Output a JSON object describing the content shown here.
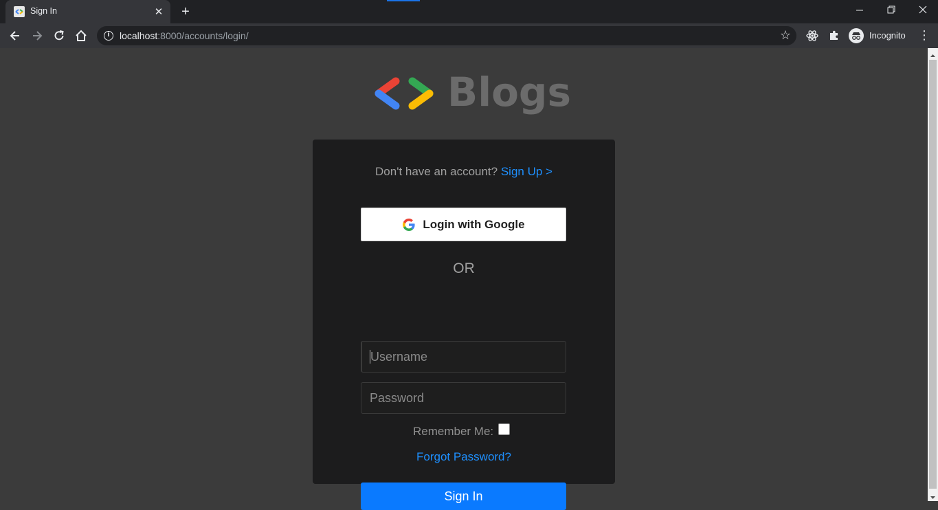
{
  "browser": {
    "tab_title": "Sign In",
    "tab_close": "✕",
    "new_tab": "+",
    "url_host": "localhost",
    "url_rest": ":8000/accounts/login/",
    "profile_label": "Incognito",
    "menu": "⋮",
    "star": "☆"
  },
  "brand": {
    "name": "Blogs",
    "logo_colors": [
      "#ea4335",
      "#4285f4",
      "#34a853",
      "#fbbc04"
    ]
  },
  "login": {
    "signup_prompt": "Don't have an account?",
    "signup_link": "Sign Up >",
    "google_label": "Login with Google",
    "or_text": "OR",
    "username_placeholder": "Username",
    "password_placeholder": "Password",
    "remember_label": "Remember Me:",
    "remember_checked": false,
    "forgot_label": "Forgot Password?",
    "signin_label": "Sign In"
  },
  "colors": {
    "accent": "#0a7aff",
    "link": "#1e90ff",
    "card_bg": "#1c1c1d",
    "page_bg": "#3b3b3b"
  }
}
